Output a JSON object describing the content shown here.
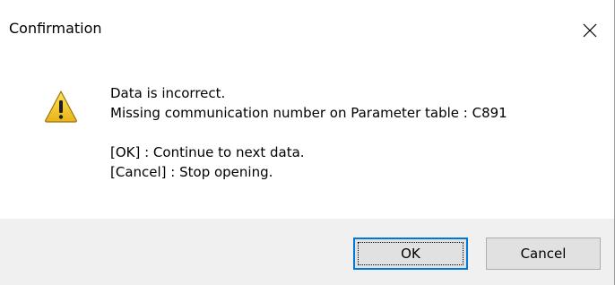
{
  "window": {
    "title": "Confirmation",
    "close_icon": "close-icon"
  },
  "message": {
    "icon": "warning-icon",
    "lines": [
      "Data is incorrect.",
      "Missing communication number on Parameter table : C891",
      "[OK] : Continue to next data.",
      "[Cancel] : Stop opening."
    ]
  },
  "buttons": {
    "ok_label": "OK",
    "cancel_label": "Cancel"
  },
  "colors": {
    "footer_bg": "#f0f0f0",
    "focus_border": "#0078d7",
    "warning_fill": "#f6d232"
  }
}
